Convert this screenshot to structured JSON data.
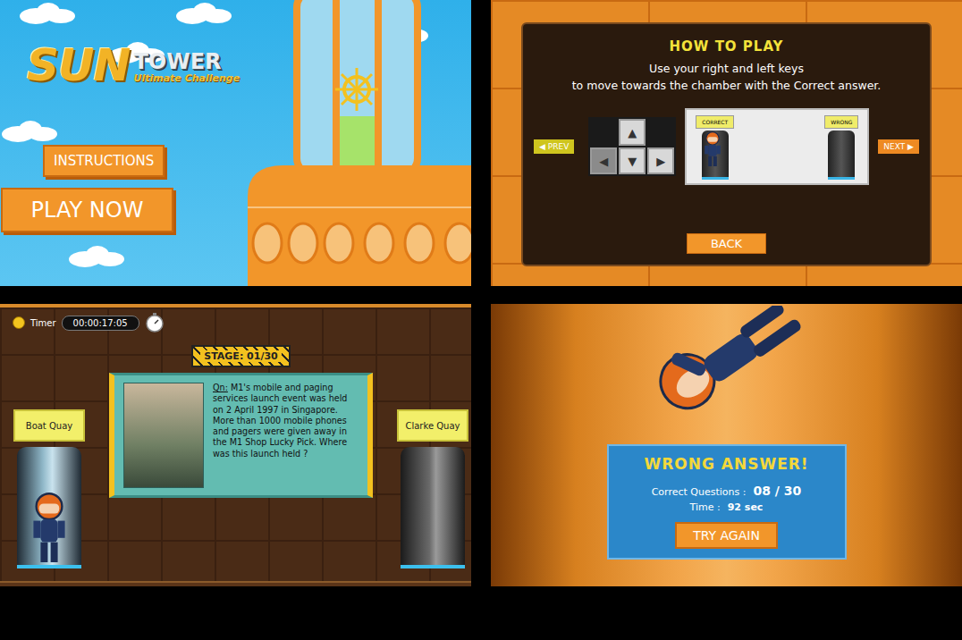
{
  "title_screen": {
    "logo": {
      "word1": "SUN",
      "word2": "TOWER",
      "subtitle": "Ultimate Challenge"
    },
    "buttons": [
      {
        "label": "INSTRUCTIONS",
        "kind": "small"
      },
      {
        "label": "PLAY NOW",
        "kind": "large"
      }
    ]
  },
  "how_to_play": {
    "title": "HOW TO PLAY",
    "lines": [
      "Use your right and left keys",
      "to move towards the chamber with the Correct answer."
    ],
    "prev": "◀ PREV",
    "next": "NEXT ▶",
    "back": "BACK",
    "keys": [
      {
        "label": "▲",
        "kind": "up",
        "pressed": false
      },
      {
        "label": "◀",
        "kind": "left",
        "pressed": true
      },
      {
        "label": "▼",
        "kind": "down",
        "pressed": false
      },
      {
        "label": "▶",
        "kind": "right",
        "pressed": false
      }
    ],
    "chambers": [
      {
        "label": "CORRECT",
        "selected": true
      },
      {
        "label": "WRONG",
        "selected": false
      }
    ]
  },
  "game": {
    "timer": {
      "label": "Timer",
      "value": "00:00:17:05"
    },
    "stage": "STAGE: 01/30",
    "question": {
      "prefix": "Qn:",
      "body": "M1's mobile and paging services launch event was held on 2 April 1997 in Singapore. More than 1000 mobile phones and pagers were given away in the M1 Shop Lucky Pick. Where was this launch held ?"
    },
    "options": [
      {
        "label": "Boat Quay",
        "selected": true
      },
      {
        "label": "Clarke Quay",
        "selected": false
      }
    ]
  },
  "result": {
    "title": "WRONG ANSWER!",
    "stats": [
      {
        "label": "Correct Questions :",
        "value": "08 / 30"
      },
      {
        "label": "Time :",
        "value": "92 sec"
      }
    ],
    "button": "TRY AGAIN"
  }
}
